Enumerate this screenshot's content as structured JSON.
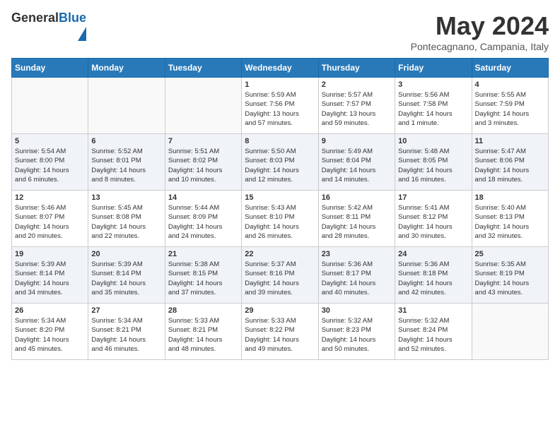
{
  "header": {
    "logo_general": "General",
    "logo_blue": "Blue",
    "title": "May 2024",
    "location": "Pontecagnano, Campania, Italy"
  },
  "days_of_week": [
    "Sunday",
    "Monday",
    "Tuesday",
    "Wednesday",
    "Thursday",
    "Friday",
    "Saturday"
  ],
  "weeks": [
    [
      {
        "day": "",
        "info": ""
      },
      {
        "day": "",
        "info": ""
      },
      {
        "day": "",
        "info": ""
      },
      {
        "day": "1",
        "info": "Sunrise: 5:59 AM\nSunset: 7:56 PM\nDaylight: 13 hours\nand 57 minutes."
      },
      {
        "day": "2",
        "info": "Sunrise: 5:57 AM\nSunset: 7:57 PM\nDaylight: 13 hours\nand 59 minutes."
      },
      {
        "day": "3",
        "info": "Sunrise: 5:56 AM\nSunset: 7:58 PM\nDaylight: 14 hours\nand 1 minute."
      },
      {
        "day": "4",
        "info": "Sunrise: 5:55 AM\nSunset: 7:59 PM\nDaylight: 14 hours\nand 3 minutes."
      }
    ],
    [
      {
        "day": "5",
        "info": "Sunrise: 5:54 AM\nSunset: 8:00 PM\nDaylight: 14 hours\nand 6 minutes."
      },
      {
        "day": "6",
        "info": "Sunrise: 5:52 AM\nSunset: 8:01 PM\nDaylight: 14 hours\nand 8 minutes."
      },
      {
        "day": "7",
        "info": "Sunrise: 5:51 AM\nSunset: 8:02 PM\nDaylight: 14 hours\nand 10 minutes."
      },
      {
        "day": "8",
        "info": "Sunrise: 5:50 AM\nSunset: 8:03 PM\nDaylight: 14 hours\nand 12 minutes."
      },
      {
        "day": "9",
        "info": "Sunrise: 5:49 AM\nSunset: 8:04 PM\nDaylight: 14 hours\nand 14 minutes."
      },
      {
        "day": "10",
        "info": "Sunrise: 5:48 AM\nSunset: 8:05 PM\nDaylight: 14 hours\nand 16 minutes."
      },
      {
        "day": "11",
        "info": "Sunrise: 5:47 AM\nSunset: 8:06 PM\nDaylight: 14 hours\nand 18 minutes."
      }
    ],
    [
      {
        "day": "12",
        "info": "Sunrise: 5:46 AM\nSunset: 8:07 PM\nDaylight: 14 hours\nand 20 minutes."
      },
      {
        "day": "13",
        "info": "Sunrise: 5:45 AM\nSunset: 8:08 PM\nDaylight: 14 hours\nand 22 minutes."
      },
      {
        "day": "14",
        "info": "Sunrise: 5:44 AM\nSunset: 8:09 PM\nDaylight: 14 hours\nand 24 minutes."
      },
      {
        "day": "15",
        "info": "Sunrise: 5:43 AM\nSunset: 8:10 PM\nDaylight: 14 hours\nand 26 minutes."
      },
      {
        "day": "16",
        "info": "Sunrise: 5:42 AM\nSunset: 8:11 PM\nDaylight: 14 hours\nand 28 minutes."
      },
      {
        "day": "17",
        "info": "Sunrise: 5:41 AM\nSunset: 8:12 PM\nDaylight: 14 hours\nand 30 minutes."
      },
      {
        "day": "18",
        "info": "Sunrise: 5:40 AM\nSunset: 8:13 PM\nDaylight: 14 hours\nand 32 minutes."
      }
    ],
    [
      {
        "day": "19",
        "info": "Sunrise: 5:39 AM\nSunset: 8:14 PM\nDaylight: 14 hours\nand 34 minutes."
      },
      {
        "day": "20",
        "info": "Sunrise: 5:39 AM\nSunset: 8:14 PM\nDaylight: 14 hours\nand 35 minutes."
      },
      {
        "day": "21",
        "info": "Sunrise: 5:38 AM\nSunset: 8:15 PM\nDaylight: 14 hours\nand 37 minutes."
      },
      {
        "day": "22",
        "info": "Sunrise: 5:37 AM\nSunset: 8:16 PM\nDaylight: 14 hours\nand 39 minutes."
      },
      {
        "day": "23",
        "info": "Sunrise: 5:36 AM\nSunset: 8:17 PM\nDaylight: 14 hours\nand 40 minutes."
      },
      {
        "day": "24",
        "info": "Sunrise: 5:36 AM\nSunset: 8:18 PM\nDaylight: 14 hours\nand 42 minutes."
      },
      {
        "day": "25",
        "info": "Sunrise: 5:35 AM\nSunset: 8:19 PM\nDaylight: 14 hours\nand 43 minutes."
      }
    ],
    [
      {
        "day": "26",
        "info": "Sunrise: 5:34 AM\nSunset: 8:20 PM\nDaylight: 14 hours\nand 45 minutes."
      },
      {
        "day": "27",
        "info": "Sunrise: 5:34 AM\nSunset: 8:21 PM\nDaylight: 14 hours\nand 46 minutes."
      },
      {
        "day": "28",
        "info": "Sunrise: 5:33 AM\nSunset: 8:21 PM\nDaylight: 14 hours\nand 48 minutes."
      },
      {
        "day": "29",
        "info": "Sunrise: 5:33 AM\nSunset: 8:22 PM\nDaylight: 14 hours\nand 49 minutes."
      },
      {
        "day": "30",
        "info": "Sunrise: 5:32 AM\nSunset: 8:23 PM\nDaylight: 14 hours\nand 50 minutes."
      },
      {
        "day": "31",
        "info": "Sunrise: 5:32 AM\nSunset: 8:24 PM\nDaylight: 14 hours\nand 52 minutes."
      },
      {
        "day": "",
        "info": ""
      }
    ]
  ]
}
